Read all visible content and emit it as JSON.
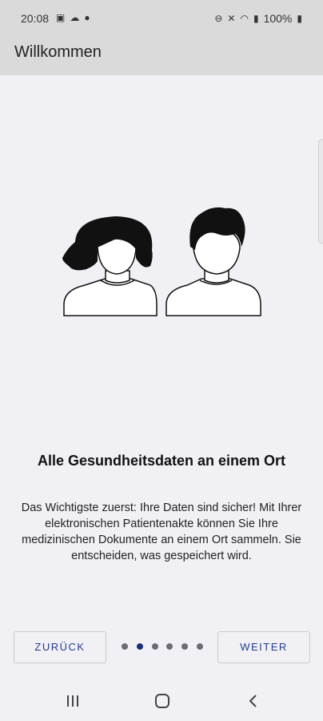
{
  "status_bar": {
    "time": "20:08",
    "battery": "100%",
    "left_icons": [
      "gallery-icon",
      "cloud-icon",
      "location-icon"
    ],
    "right_icons": [
      "link-icon",
      "mute-icon",
      "wifi-icon",
      "signal-icon",
      "battery-icon"
    ]
  },
  "app_bar": {
    "title": "Willkommen"
  },
  "onboarding": {
    "headline": "Alle Gesundheitsdaten an einem Ort",
    "body": "Das Wichtigste zuerst: Ihre Daten sind sicher! Mit Ihrer elektronischen Patientenakte können Sie Ihre medizinischen Dokumente an einem Ort sammeln. Sie entscheiden, was gespeichert wird.",
    "illustration": "two-people-avatars",
    "page_count": 6,
    "current_page": 2
  },
  "buttons": {
    "back_label": "ZURÜCK",
    "next_label": "WEITER"
  },
  "navigation": {
    "icons": [
      "recent-apps-icon",
      "home-icon",
      "back-icon"
    ]
  },
  "colors": {
    "accent": "#243a8f",
    "background": "#f1f1f5",
    "toolbar": "#dadada"
  }
}
